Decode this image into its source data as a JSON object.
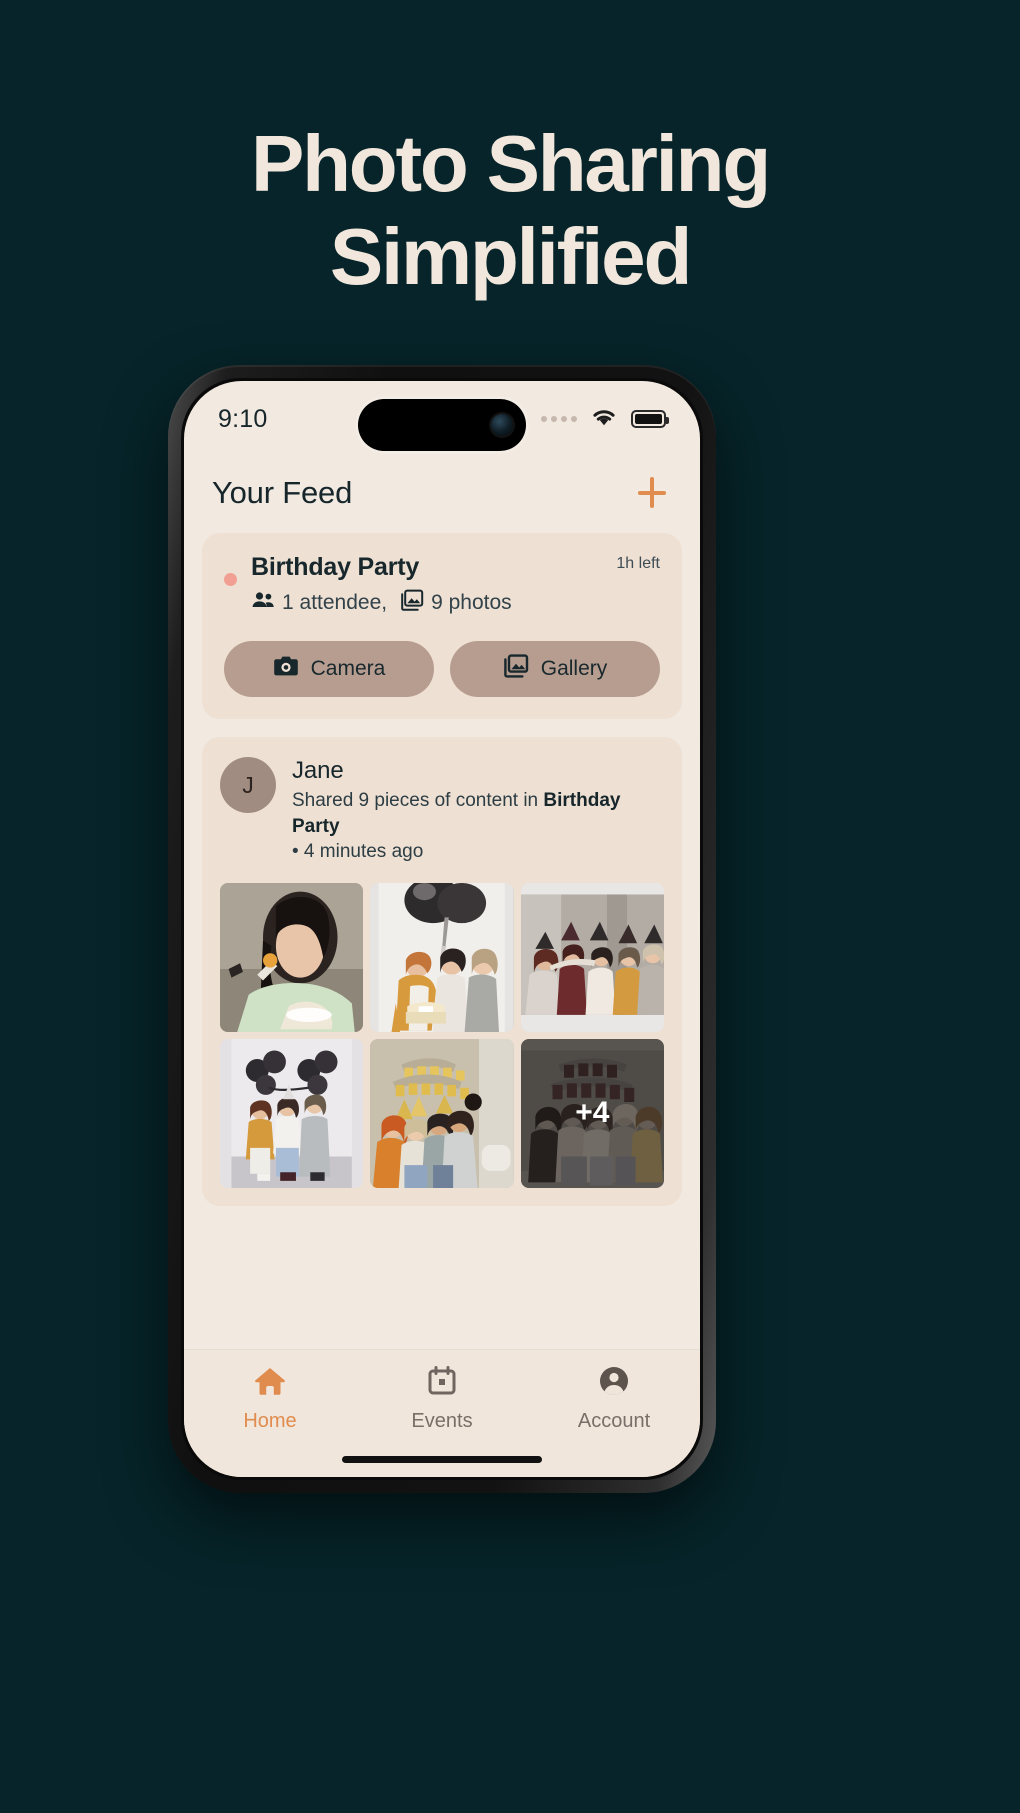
{
  "theme": {
    "page_bg": "#062429",
    "headline_color": "#F2E7DC",
    "screen_bg": "#F2E9E0",
    "card_bg": "#EEE0D3",
    "accent_orange": "#E08C4E",
    "pill_bg": "#B79D90",
    "live_dot": "#F19F93",
    "avatar_bg": "#A08C80",
    "text_dark": "#16262B",
    "text_muted": "#7A6F68"
  },
  "headline": {
    "line1": "Photo Sharing",
    "line2": "Simplified"
  },
  "status_bar": {
    "time": "9:10",
    "signal_icon": "signal-dots-icon",
    "wifi_icon": "wifi-icon",
    "battery_icon": "battery-icon",
    "camera_icon": "front-camera-icon"
  },
  "app_header": {
    "title": "Your Feed",
    "add_icon": "plus-icon"
  },
  "event_card": {
    "live_dot_icon": "live-dot-icon",
    "name": "Birthday Party",
    "time_left": "1h left",
    "attendees_icon": "people-icon",
    "attendees": "1 attendee,",
    "photos_icon": "photo-stack-icon",
    "photos": "9 photos",
    "buttons": [
      {
        "label": "Camera",
        "icon": "camera-icon"
      },
      {
        "label": "Gallery",
        "icon": "gallery-icon"
      }
    ]
  },
  "post": {
    "avatar_initial": "J",
    "user": "Jane",
    "summary_prefix": "Shared 9 pieces of content in ",
    "summary_event": "Birthday Party",
    "summary_suffix": "• 4 minutes ago",
    "photos": [
      {
        "alt": "woman eating cake with fork"
      },
      {
        "alt": "friends holding balloons and cake"
      },
      {
        "alt": "friends in party hats toasting"
      },
      {
        "alt": "four friends posing with balloons"
      },
      {
        "alt": "group in party hats looking at phone"
      },
      {
        "alt": "group under happy birthday banner",
        "more_count": "+4"
      }
    ]
  },
  "tabbar": {
    "items": [
      {
        "label": "Home",
        "icon": "home-icon",
        "active": true
      },
      {
        "label": "Events",
        "icon": "calendar-icon",
        "active": false
      },
      {
        "label": "Account",
        "icon": "account-icon",
        "active": false
      }
    ]
  }
}
